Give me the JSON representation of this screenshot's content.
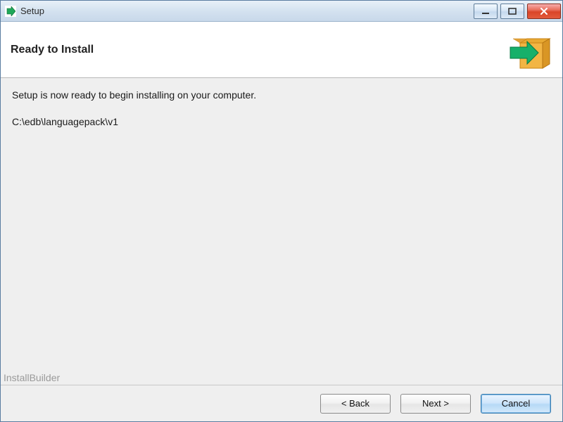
{
  "window": {
    "title": "Setup"
  },
  "header": {
    "heading": "Ready to Install"
  },
  "body": {
    "description": "Setup is now ready to begin installing on your computer.",
    "install_path": "C:\\edb\\languagepack\\v1"
  },
  "watermark": "InstallBuilder",
  "footer": {
    "back_label": "< Back",
    "next_label": "Next >",
    "cancel_label": "Cancel"
  }
}
